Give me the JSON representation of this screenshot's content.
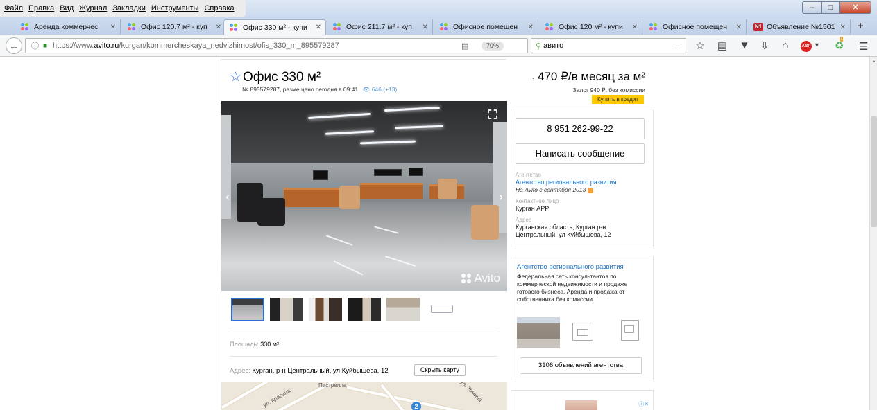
{
  "menu": {
    "items": [
      "Файл",
      "Правка",
      "Вид",
      "Журнал",
      "Закладки",
      "Инструменты",
      "Справка"
    ]
  },
  "tabs": [
    {
      "label": "Аренда коммерчес",
      "icon": "avito-icon",
      "active": false
    },
    {
      "label": "Офис 120.7 м² - куп",
      "icon": "avito-icon",
      "active": false
    },
    {
      "label": "Офис 330 м² - купи",
      "icon": "avito-icon",
      "active": true
    },
    {
      "label": "Офис 211.7 м² - куп",
      "icon": "avito-icon",
      "active": false
    },
    {
      "label": "Офисное помещен",
      "icon": "avito-icon",
      "active": false
    },
    {
      "label": "Офис 120 м² - купи",
      "icon": "avito-icon",
      "active": false
    },
    {
      "label": "Офисное помещен",
      "icon": "avito-icon",
      "active": false
    },
    {
      "label": "Объявление №1501",
      "icon": "n1-icon",
      "active": false
    }
  ],
  "tab_icon_n1": "N1",
  "nav": {
    "url_prefix": "https://www.",
    "url_domain": "avito.ru",
    "url_path": "/kurgan/kommercheskaya_nedvizhimost/ofis_330_m_895579287",
    "zoom": "70%",
    "search_value": "авито"
  },
  "ad": {
    "title": "Офис 330 м²",
    "meta": "№ 895579287, размещено сегодня в 09:41",
    "views": "646 (+13)",
    "watermark": "Avito",
    "area_label": "Площадь:",
    "area_value": "330 м²",
    "address_label": "Адрес:",
    "address_value": "Курган, р-н Центральный, ул Куйбышева, 12",
    "hide_map": "Скрыть карту",
    "map_labels": {
      "street1": "ул. Красина",
      "street2": "ул. Томина",
      "street3": "Пастрелла",
      "pin": "2"
    }
  },
  "seller": {
    "price": "470 ₽/в месяц за м²",
    "deposit": "Залог 940 ₽, без комиссии",
    "credit": "Купить в кредит",
    "phone": "8 951 262-99-22",
    "message": "Написать сообщение",
    "agency_label": "Агентство",
    "agency_name": "Агентство регионального развития",
    "since": "На Avito с сентября 2013",
    "contact_label": "Контактное лицо",
    "contact_value": "Курган АРР",
    "address_label": "Адрес",
    "address_line1": "Курганская область, Курган р-н",
    "address_line2": "Центральный, ул Куйбышева, 12"
  },
  "promo": {
    "title": "Агентство регионального развития",
    "text": "Федеральная сеть консультантов по коммерческой недвижимости и продаже готового бизнеса. Аренда и продажа от собственника без комиссии.",
    "button": "3106 объявлений агентства"
  },
  "colors": {
    "link": "#1a73c8",
    "credit": "#ffc800",
    "star": "#2a6dd3"
  }
}
